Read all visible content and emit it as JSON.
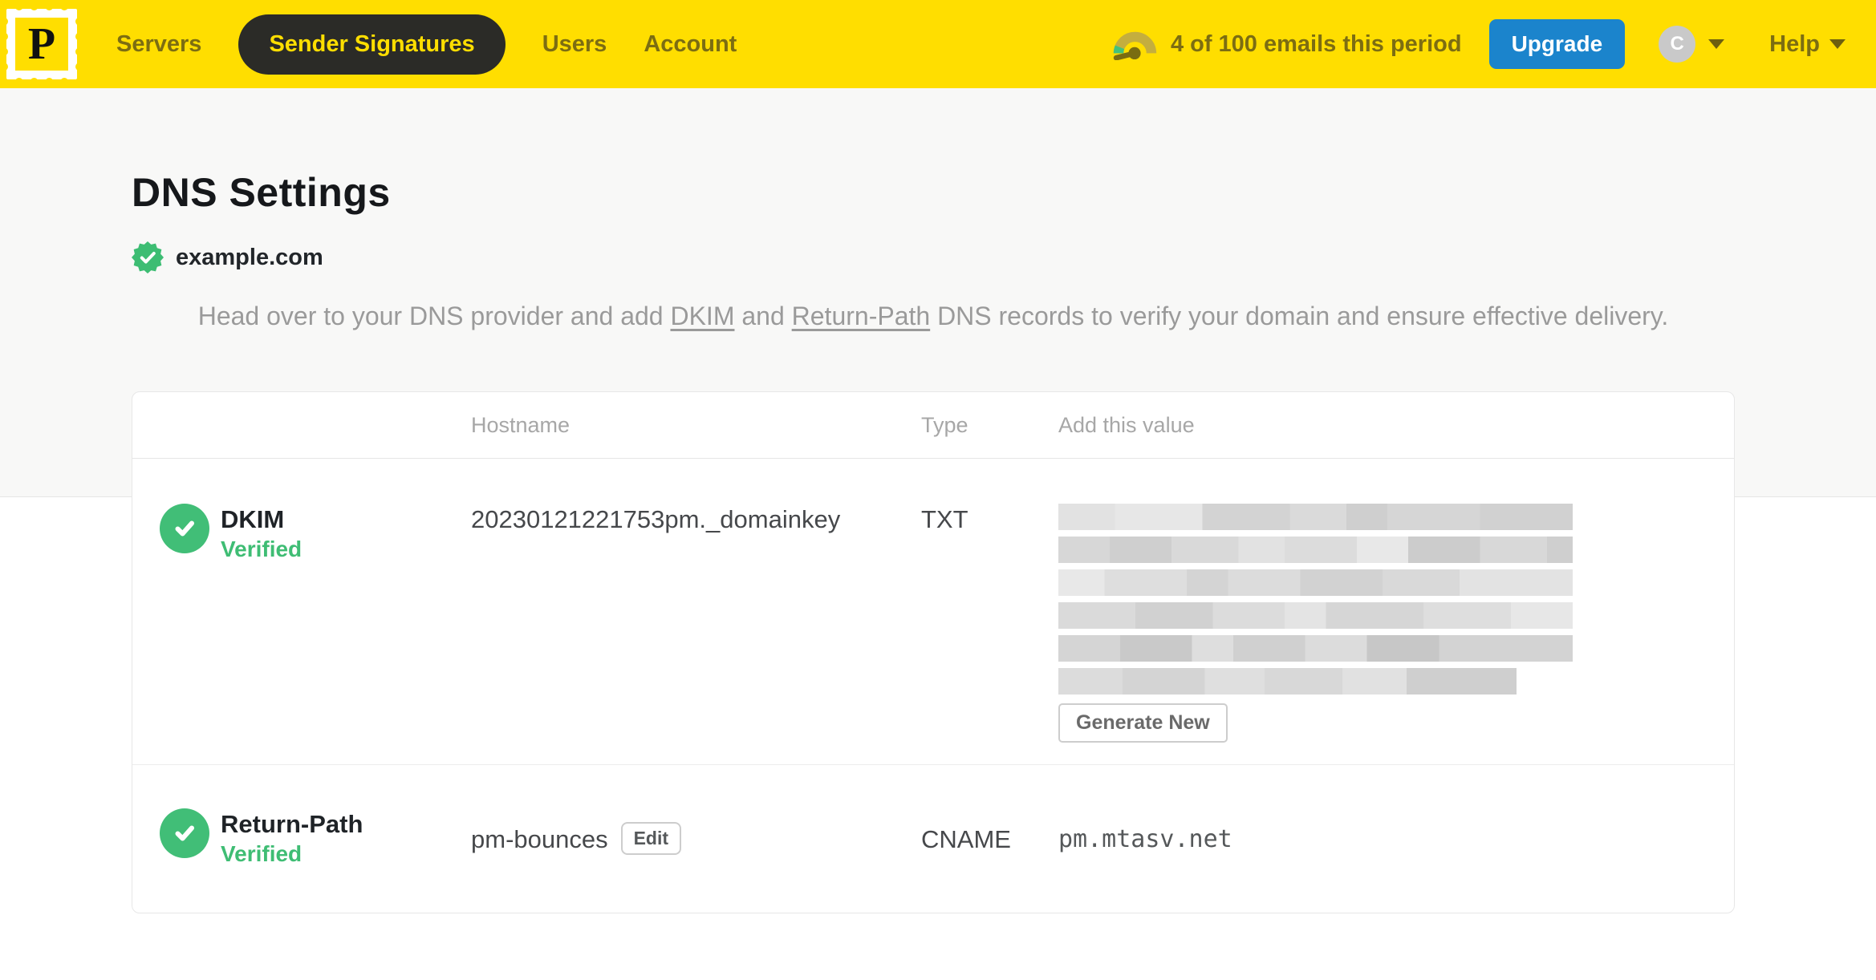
{
  "nav": {
    "logo_letter": "P",
    "items": [
      {
        "label": "Servers",
        "active": false
      },
      {
        "label": "Sender Signatures",
        "active": true
      },
      {
        "label": "Users",
        "active": false
      },
      {
        "label": "Account",
        "active": false
      }
    ],
    "usage_text": "4 of 100 emails this period",
    "upgrade_label": "Upgrade",
    "avatar_initial": "C",
    "help_label": "Help"
  },
  "page": {
    "title": "DNS Settings",
    "domain": "example.com",
    "intro": {
      "part1": "Head over to your DNS provider and add ",
      "link1": "DKIM",
      "part2": " and ",
      "link2": "Return-Path",
      "part3": " DNS records to verify your domain and ensure effective delivery."
    }
  },
  "table": {
    "headers": {
      "hostname": "Hostname",
      "type": "Type",
      "value": "Add this value"
    },
    "rows": [
      {
        "record": "DKIM",
        "status": "Verified",
        "hostname": "20230121221753pm._domainkey",
        "type": "TXT",
        "value_redacted": true,
        "action_label": "Generate New"
      },
      {
        "record": "Return-Path",
        "status": "Verified",
        "hostname": "pm-bounces",
        "edit_label": "Edit",
        "type": "CNAME",
        "value": "pm.mtasv.net"
      }
    ]
  },
  "colors": {
    "brand_yellow": "#ffde00",
    "nav_text": "#7c6d12",
    "nav_active_bg": "#2b2b27",
    "nav_active_text": "#ffde00",
    "upgrade_blue": "#1b84cc",
    "verified_green": "#41be77",
    "title_color": "#16181b",
    "muted_text": "#9a9a9a",
    "header_text": "#a7a7a7",
    "body_text": "#46484b",
    "hero_bg": "#f8f8f7",
    "line": "#e5e5e5"
  }
}
